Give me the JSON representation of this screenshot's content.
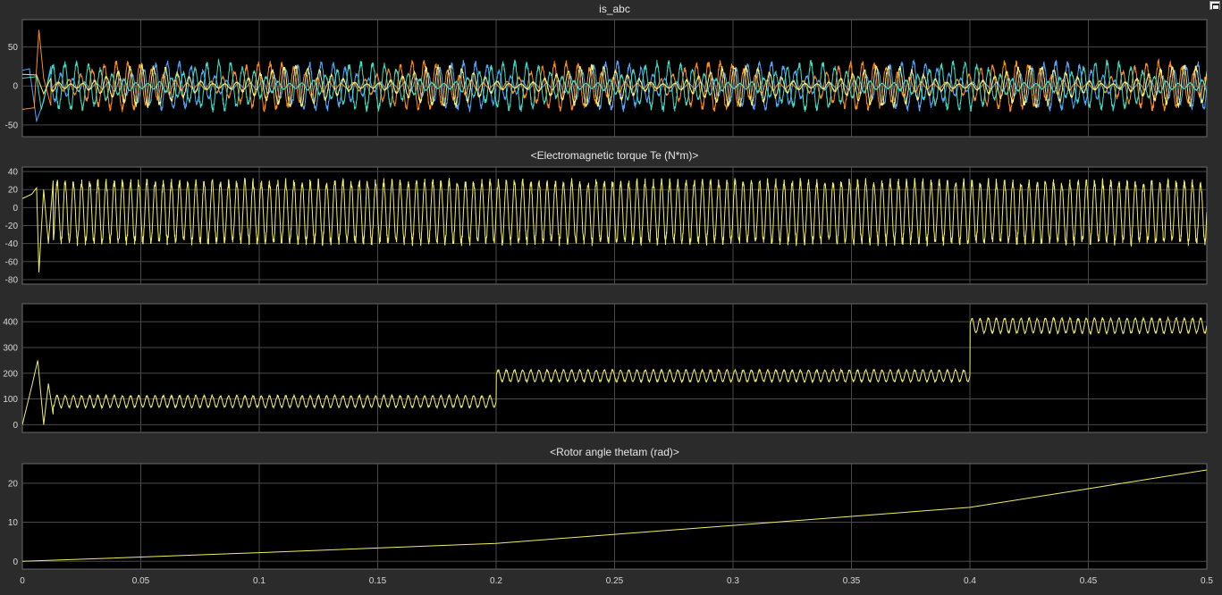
{
  "window": {
    "restore_icon": "restore-window-icon"
  },
  "colors": {
    "background": "#2b2b2b",
    "plot_bg": "#000000",
    "grid": "#4a4a4a",
    "axis_text": "#d8d8d8",
    "title_text": "#e6e6e6",
    "phase_a": "#f4f07a",
    "phase_b": "#4da6ff",
    "phase_c": "#ff8c1a",
    "phase_d": "#3de0c8",
    "signal": "#f2ee63"
  },
  "chart_data": [
    {
      "type": "line",
      "title": "is_abc",
      "xlim": [
        0,
        0.5
      ],
      "ylim": [
        -65,
        85
      ],
      "yticks": [
        -50,
        0,
        50
      ],
      "xtick_labels_shown": false,
      "grid": true,
      "series": [
        {
          "color": "#4da6ff",
          "amplitude": 30,
          "carrier_hz": 200,
          "envelope_hz": 16,
          "phase": 0,
          "startup": [
            [
              0,
              20
            ],
            [
              0.003,
              22
            ],
            [
              0.006,
              -45
            ],
            [
              0.009,
              -20
            ],
            [
              0.012,
              25
            ]
          ]
        },
        {
          "color": "#ff8c1a",
          "amplitude": 30,
          "carrier_hz": 200,
          "envelope_hz": 16,
          "phase": 2.094,
          "startup": [
            [
              0,
              -30
            ],
            [
              0.005,
              -28
            ],
            [
              0.007,
              72
            ],
            [
              0.009,
              10
            ],
            [
              0.012,
              -25
            ]
          ]
        },
        {
          "color": "#3de0c8",
          "amplitude": 30,
          "carrier_hz": 200,
          "envelope_hz": 16,
          "phase": 4.189,
          "startup": [
            [
              0,
              10
            ],
            [
              0.006,
              12
            ],
            [
              0.008,
              -30
            ],
            [
              0.012,
              20
            ]
          ]
        },
        {
          "color": "#f4f07a",
          "amplitude": 25,
          "carrier_hz": 200,
          "envelope_hz": 16,
          "phase": 1.0,
          "startup": [
            [
              0,
              15
            ],
            [
              0.006,
              14
            ],
            [
              0.009,
              -10
            ],
            [
              0.012,
              10
            ]
          ]
        }
      ]
    },
    {
      "type": "line",
      "title": "<Electromagnetic torque Te (N*m)>",
      "xlim": [
        0,
        0.5
      ],
      "ylim": [
        -85,
        45
      ],
      "yticks": [
        -80,
        -60,
        -40,
        -20,
        0,
        20,
        40
      ],
      "xtick_labels_shown": false,
      "grid": true,
      "series": [
        {
          "color": "#f2ee63",
          "mean": -5,
          "amplitude": 33,
          "carrier_hz": 290,
          "startup": [
            [
              0,
              10
            ],
            [
              0.004,
              15
            ],
            [
              0.006,
              22
            ],
            [
              0.007,
              -72
            ],
            [
              0.009,
              20
            ],
            [
              0.011,
              -40
            ],
            [
              0.013,
              30
            ]
          ]
        }
      ]
    },
    {
      "type": "line",
      "title": "",
      "xlim": [
        0,
        0.5
      ],
      "ylim": [
        -30,
        470
      ],
      "yticks": [
        0,
        100,
        200,
        300,
        400
      ],
      "xtick_labels_shown": false,
      "grid": true,
      "series": [
        {
          "color": "#f2ee63",
          "segments": [
            {
              "t_start": 0.0,
              "t_end": 0.2,
              "mean": 90,
              "amplitude": 22
            },
            {
              "t_start": 0.2,
              "t_end": 0.4,
              "mean": 190,
              "amplitude": 22
            },
            {
              "t_start": 0.4,
              "t_end": 0.5,
              "mean": 385,
              "amplitude": 28
            }
          ],
          "carrier_hz": 290,
          "startup": [
            [
              0,
              0
            ],
            [
              0.004,
              150
            ],
            [
              0.0065,
              250
            ],
            [
              0.009,
              0
            ],
            [
              0.011,
              160
            ],
            [
              0.013,
              40
            ]
          ]
        }
      ]
    },
    {
      "type": "line",
      "title": "<Rotor angle thetam (rad)>",
      "xlim": [
        0,
        0.5
      ],
      "ylim": [
        -2,
        25
      ],
      "yticks": [
        0,
        10,
        20
      ],
      "xticks": [
        0,
        0.05,
        0.1,
        0.15,
        0.2,
        0.25,
        0.3,
        0.35,
        0.4,
        0.45,
        0.5
      ],
      "xtick_labels": [
        "0",
        "0.05",
        "0.1",
        "0.15",
        "0.2",
        "0.25",
        "0.3",
        "0.35",
        "0.4",
        "0.45",
        "0.5"
      ],
      "xtick_labels_shown": true,
      "grid": true,
      "series": [
        {
          "color": "#f2ee63",
          "points": [
            [
              0,
              0
            ],
            [
              0.05,
              1.1
            ],
            [
              0.1,
              2.2
            ],
            [
              0.15,
              3.4
            ],
            [
              0.2,
              4.6
            ],
            [
              0.25,
              6.9
            ],
            [
              0.3,
              9.2
            ],
            [
              0.35,
              11.5
            ],
            [
              0.4,
              13.8
            ],
            [
              0.45,
              18.6
            ],
            [
              0.5,
              23.4
            ]
          ]
        }
      ]
    }
  ]
}
